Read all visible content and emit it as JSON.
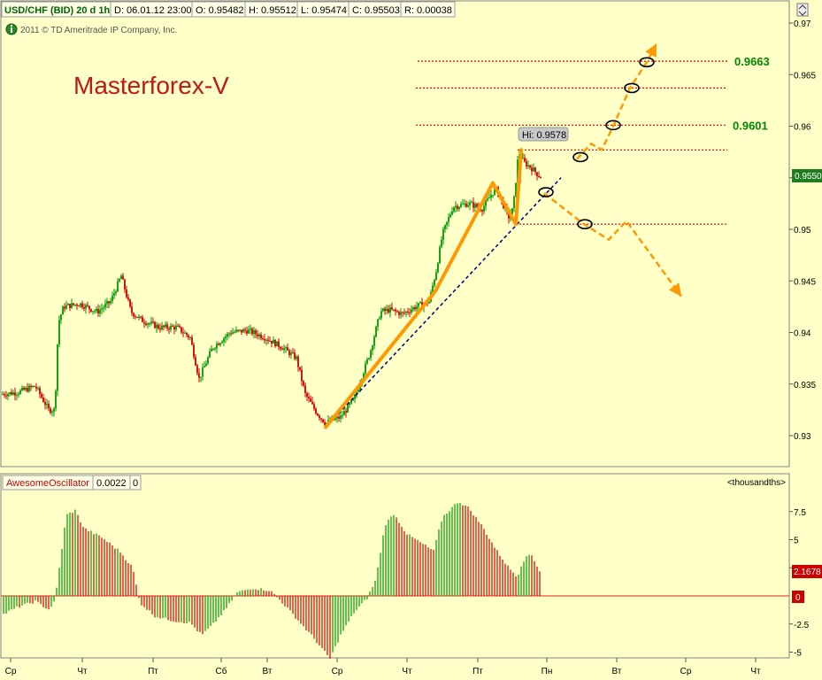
{
  "header": {
    "symbol": "USD/CHF (BID) 20 d 1h",
    "date": "D: 06.01.12 23:00",
    "open": "O: 0.95482",
    "high": "H: 0.95512",
    "low": "L: 0.95474",
    "close": "C: 0.95503",
    "range": "R: 0.00038"
  },
  "copyright": "2011 © TD Ameritrade IP Company, Inc.",
  "watermark": "Masterforex-V",
  "colors": {
    "background": "#ffffc8",
    "up_candle": "#009900",
    "down_candle": "#cc0000",
    "forecast": "#ff9900",
    "level_line": "#dd0000",
    "trend_line": "#000080",
    "level_label": "#008800"
  },
  "price_axis": {
    "ticks": [
      "0.97",
      "0.965",
      "0.96",
      "0.955",
      "0.95",
      "0.945",
      "0.94",
      "0.935",
      "0.93"
    ],
    "current_price": "0.9550"
  },
  "levels": [
    {
      "price": 0.9663,
      "label": "0.9663"
    },
    {
      "price": 0.9637,
      "label": ""
    },
    {
      "price": 0.9601,
      "label": "0.9601"
    },
    {
      "price": 0.9577,
      "label": ""
    },
    {
      "price": 0.9505,
      "label": ""
    }
  ],
  "hi_label": "Hi: 0.9578",
  "oscillator": {
    "name": "AwesomeOscillator",
    "value": "0.0022",
    "extra": "0",
    "units": "<thousandths>",
    "ticks": [
      "7.5",
      "5",
      "2.5",
      "0",
      "-2.5",
      "-5"
    ],
    "current_value": "2.1678",
    "zero_tag": "0"
  },
  "time_axis": [
    "Ср",
    "Чт",
    "Пт",
    "Сб",
    "Вт",
    "Ср",
    "Чт",
    "Пт",
    "Пн",
    "Вт",
    "Ср",
    "Чт"
  ],
  "chart_data": {
    "type": "candlestick",
    "title": "USD/CHF (BID) 20 d 1h",
    "ylim": [
      0.9277,
      0.9717
    ],
    "path_anchors": [
      [
        0,
        0.934
      ],
      [
        20,
        0.9342
      ],
      [
        40,
        0.9348
      ],
      [
        55,
        0.9325
      ],
      [
        62,
        0.9325
      ],
      [
        66,
        0.941
      ],
      [
        72,
        0.9425
      ],
      [
        90,
        0.9428
      ],
      [
        110,
        0.942
      ],
      [
        125,
        0.943
      ],
      [
        137,
        0.9455
      ],
      [
        148,
        0.942
      ],
      [
        160,
        0.9412
      ],
      [
        180,
        0.9405
      ],
      [
        200,
        0.9405
      ],
      [
        215,
        0.9395
      ],
      [
        225,
        0.9355
      ],
      [
        240,
        0.9385
      ],
      [
        260,
        0.94
      ],
      [
        280,
        0.9402
      ],
      [
        300,
        0.9395
      ],
      [
        320,
        0.9385
      ],
      [
        335,
        0.9375
      ],
      [
        345,
        0.934
      ],
      [
        358,
        0.9322
      ],
      [
        368,
        0.9312
      ],
      [
        385,
        0.9318
      ],
      [
        400,
        0.9335
      ],
      [
        418,
        0.938
      ],
      [
        430,
        0.942
      ],
      [
        440,
        0.9422
      ],
      [
        455,
        0.9418
      ],
      [
        470,
        0.9425
      ],
      [
        485,
        0.943
      ],
      [
        493,
        0.946
      ],
      [
        500,
        0.9495
      ],
      [
        512,
        0.9522
      ],
      [
        530,
        0.9525
      ],
      [
        545,
        0.952
      ],
      [
        560,
        0.954
      ],
      [
        568,
        0.9525
      ],
      [
        575,
        0.9512
      ],
      [
        580,
        0.952
      ],
      [
        586,
        0.9575
      ],
      [
        592,
        0.9565
      ],
      [
        600,
        0.956
      ],
      [
        608,
        0.9553
      ],
      [
        612,
        0.955
      ]
    ],
    "ao_anchors": [
      [
        0,
        -1.8
      ],
      [
        20,
        -1.0
      ],
      [
        40,
        -0.5
      ],
      [
        55,
        -1.2
      ],
      [
        62,
        -0.5
      ],
      [
        75,
        7.2
      ],
      [
        85,
        7.6
      ],
      [
        95,
        6.0
      ],
      [
        115,
        5.2
      ],
      [
        135,
        4.0
      ],
      [
        150,
        2.5
      ],
      [
        158,
        -0.6
      ],
      [
        175,
        -1.8
      ],
      [
        195,
        -2.2
      ],
      [
        215,
        -2.4
      ],
      [
        228,
        -3.5
      ],
      [
        240,
        -2.6
      ],
      [
        255,
        -1.2
      ],
      [
        268,
        0.3
      ],
      [
        285,
        0.7
      ],
      [
        305,
        0.5
      ],
      [
        318,
        -0.5
      ],
      [
        335,
        -2.0
      ],
      [
        355,
        -3.8
      ],
      [
        373,
        -5.6
      ],
      [
        385,
        -3.5
      ],
      [
        400,
        -1.5
      ],
      [
        415,
        -0.2
      ],
      [
        425,
        1.5
      ],
      [
        435,
        6.3
      ],
      [
        445,
        7.3
      ],
      [
        460,
        5.5
      ],
      [
        480,
        4.5
      ],
      [
        490,
        4.0
      ],
      [
        500,
        7.0
      ],
      [
        518,
        8.4
      ],
      [
        530,
        7.8
      ],
      [
        545,
        6.2
      ],
      [
        560,
        4.2
      ],
      [
        575,
        2.5
      ],
      [
        585,
        1.7
      ],
      [
        590,
        3.0
      ],
      [
        600,
        3.8
      ],
      [
        610,
        2.2
      ]
    ],
    "forecast_up": [
      [
        652,
        0.9568
      ],
      [
        668,
        0.9583
      ],
      [
        680,
        0.9577
      ],
      [
        693,
        0.96
      ],
      [
        712,
        0.9637
      ],
      [
        731,
        0.9662
      ],
      [
        742,
        0.968
      ]
    ],
    "forecast_down": [
      [
        615,
        0.9535
      ],
      [
        660,
        0.9505
      ],
      [
        688,
        0.949
      ],
      [
        708,
        0.9508
      ],
      [
        770,
        0.9435
      ]
    ],
    "trend_line": [
      [
        368,
        0.9308
      ],
      [
        634,
        0.955
      ]
    ],
    "solid_path": [
      [
        368,
        0.9308
      ],
      [
        492,
        0.944
      ],
      [
        557,
        0.9545
      ],
      [
        583,
        0.9505
      ],
      [
        589,
        0.9577
      ]
    ]
  }
}
